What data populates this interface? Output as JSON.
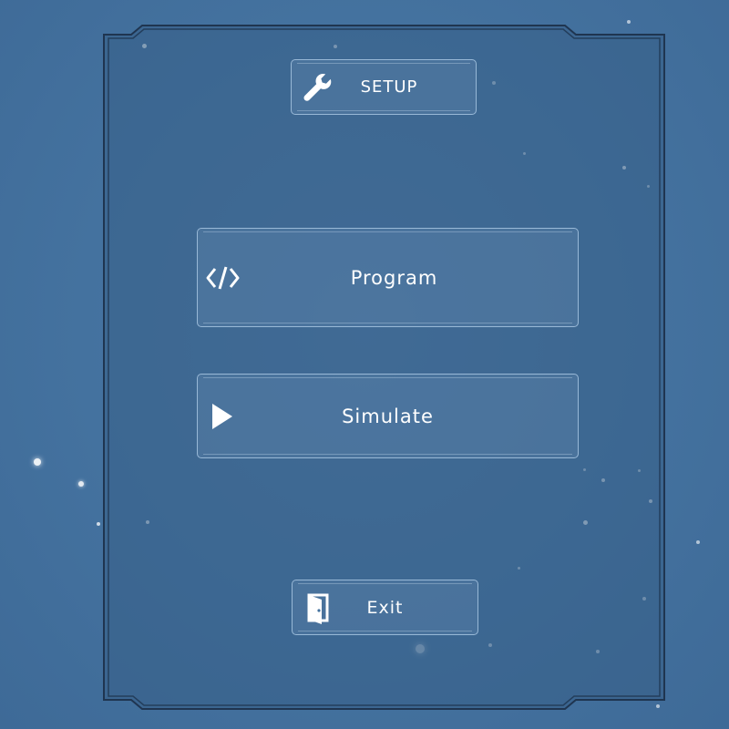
{
  "menu": {
    "setup": {
      "label": "SETUP",
      "icon": "wrench-icon"
    },
    "program": {
      "label": "Program",
      "icon": "code-icon"
    },
    "simulate": {
      "label": "Simulate",
      "icon": "play-icon"
    },
    "exit": {
      "label": "Exit",
      "icon": "exit-door-icon"
    }
  },
  "colors": {
    "background": "#44729f",
    "panel": "#3f6892",
    "frame_border": "#1f3550",
    "button_border": "#b4d0eb",
    "text": "#ffffff"
  }
}
